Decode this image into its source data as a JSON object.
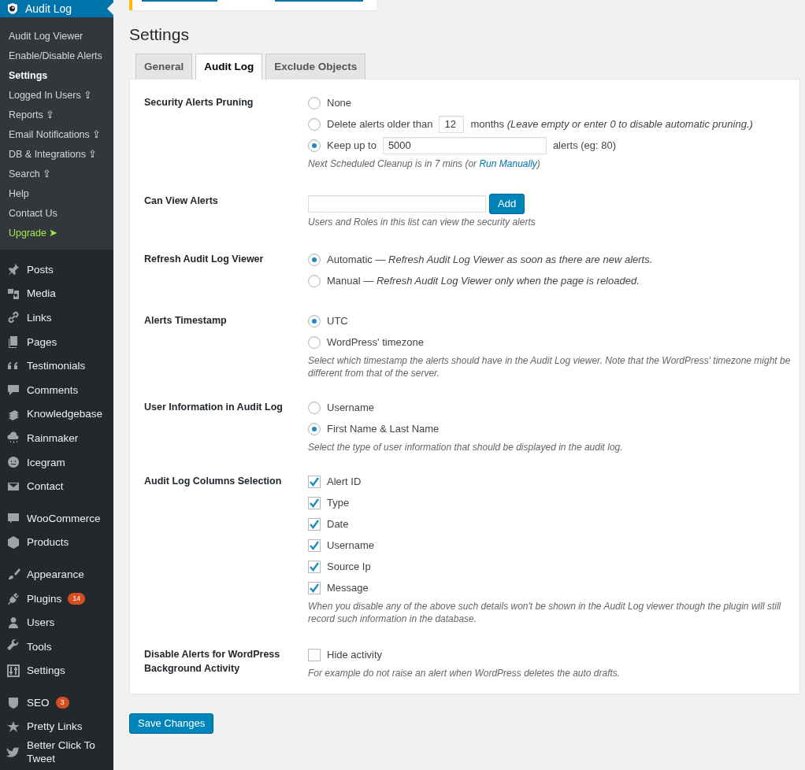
{
  "sidebar": {
    "header": {
      "label": "Audit Log"
    },
    "submenu": [
      {
        "label": "Audit Log Viewer",
        "selected": false,
        "kind": "normal"
      },
      {
        "label": "Enable/Disable Alerts",
        "selected": false,
        "kind": "normal"
      },
      {
        "label": "Settings",
        "selected": true,
        "kind": "normal"
      },
      {
        "label": "Logged In Users ⇪",
        "selected": false,
        "kind": "normal"
      },
      {
        "label": "Reports ⇪",
        "selected": false,
        "kind": "normal"
      },
      {
        "label": "Email Notifications ⇪",
        "selected": false,
        "kind": "normal"
      },
      {
        "label": "DB & Integrations ⇪",
        "selected": false,
        "kind": "normal"
      },
      {
        "label": "Search ⇪",
        "selected": false,
        "kind": "normal"
      },
      {
        "label": "Help",
        "selected": false,
        "kind": "normal"
      },
      {
        "label": "Contact Us",
        "selected": false,
        "kind": "normal"
      },
      {
        "label": "Upgrade ➤",
        "selected": false,
        "kind": "upgrade"
      }
    ],
    "groups": [
      [
        {
          "label": "Posts"
        },
        {
          "label": "Media"
        },
        {
          "label": "Links"
        },
        {
          "label": "Pages"
        },
        {
          "label": "Testimonials"
        },
        {
          "label": "Comments"
        },
        {
          "label": "Knowledgebase"
        },
        {
          "label": "Rainmaker"
        },
        {
          "label": "Icegram"
        },
        {
          "label": "Contact"
        }
      ],
      [
        {
          "label": "WooCommerce"
        },
        {
          "label": "Products"
        }
      ],
      [
        {
          "label": "Appearance"
        },
        {
          "label": "Plugins",
          "badge": "14"
        },
        {
          "label": "Users"
        },
        {
          "label": "Tools"
        },
        {
          "label": "Settings"
        }
      ],
      [
        {
          "label": "SEO",
          "badge": "3"
        },
        {
          "label": "Pretty Links"
        },
        {
          "label": "Better Click To Tweet"
        }
      ]
    ]
  },
  "page_title": "Settings",
  "tabs": [
    {
      "label": "General",
      "selected": false
    },
    {
      "label": "Audit Log",
      "selected": true
    },
    {
      "label": "Exclude Objects",
      "selected": false
    }
  ],
  "sections": [
    {
      "label": "Security Alerts Pruning",
      "kind": "radio",
      "options": [
        {
          "label": "None",
          "selected": false
        },
        {
          "kind": "months",
          "label": "Delete alerts older than",
          "value": "12",
          "suffix": "months",
          "note": "(Leave empty or enter 0 to disable automatic pruning.)",
          "selected": false
        },
        {
          "kind": "count",
          "label": "Keep up to",
          "value": "5000",
          "suffix": "alerts (eg: 80)",
          "selected": true
        }
      ],
      "description": "Next Scheduled Cleanup is in 7 mins (or ",
      "link": "Run Manually",
      "description_end": ")"
    },
    {
      "label": "Can View Alerts",
      "kind": "add",
      "button": "Add",
      "description": "Users and Roles in this list can view the security alerts"
    },
    {
      "label": "Refresh Audit Log Viewer",
      "kind": "radio",
      "options": [
        {
          "label": "Automatic — *Refresh Audit Log Viewer as soon as there are new alerts.*",
          "selected": true
        },
        {
          "label": "Manual — *Refresh Audit Log Viewer only when the page is reloaded.*",
          "selected": false
        }
      ]
    },
    {
      "label": "Alerts Timestamp",
      "kind": "radio",
      "options": [
        {
          "label": "UTC",
          "selected": true
        },
        {
          "label": "WordPress' timezone",
          "selected": false
        }
      ],
      "description": "Select which timestamp the alerts should have in the Audit Log viewer. Note that the WordPress' timezone might be different from that of the server."
    },
    {
      "label": "User Information in Audit Log",
      "kind": "radio",
      "options": [
        {
          "label": "Username",
          "selected": false
        },
        {
          "label": "First Name & Last Name",
          "selected": true
        }
      ],
      "description": "Select the type of user information that should be displayed in the audit log."
    },
    {
      "label": "Audit Log Columns Selection",
      "kind": "checkbox",
      "options": [
        {
          "label": "Alert ID",
          "checked": true
        },
        {
          "label": "Type",
          "checked": true
        },
        {
          "label": "Date",
          "checked": true
        },
        {
          "label": "Username",
          "checked": true
        },
        {
          "label": "Source Ip",
          "checked": true
        },
        {
          "label": "Message",
          "checked": true
        }
      ],
      "description": "When you disable any of the above such details won't be shown in the Audit Log viewer though the plugin will still record such information in the database."
    },
    {
      "label": "Disable Alerts for WordPress Background Activity",
      "kind": "checkbox",
      "options": [
        {
          "label": "Hide activity",
          "checked": false
        }
      ],
      "description": "For example do not raise an alert when WordPress deletes the auto drafts."
    }
  ],
  "save_button": "Save Changes"
}
